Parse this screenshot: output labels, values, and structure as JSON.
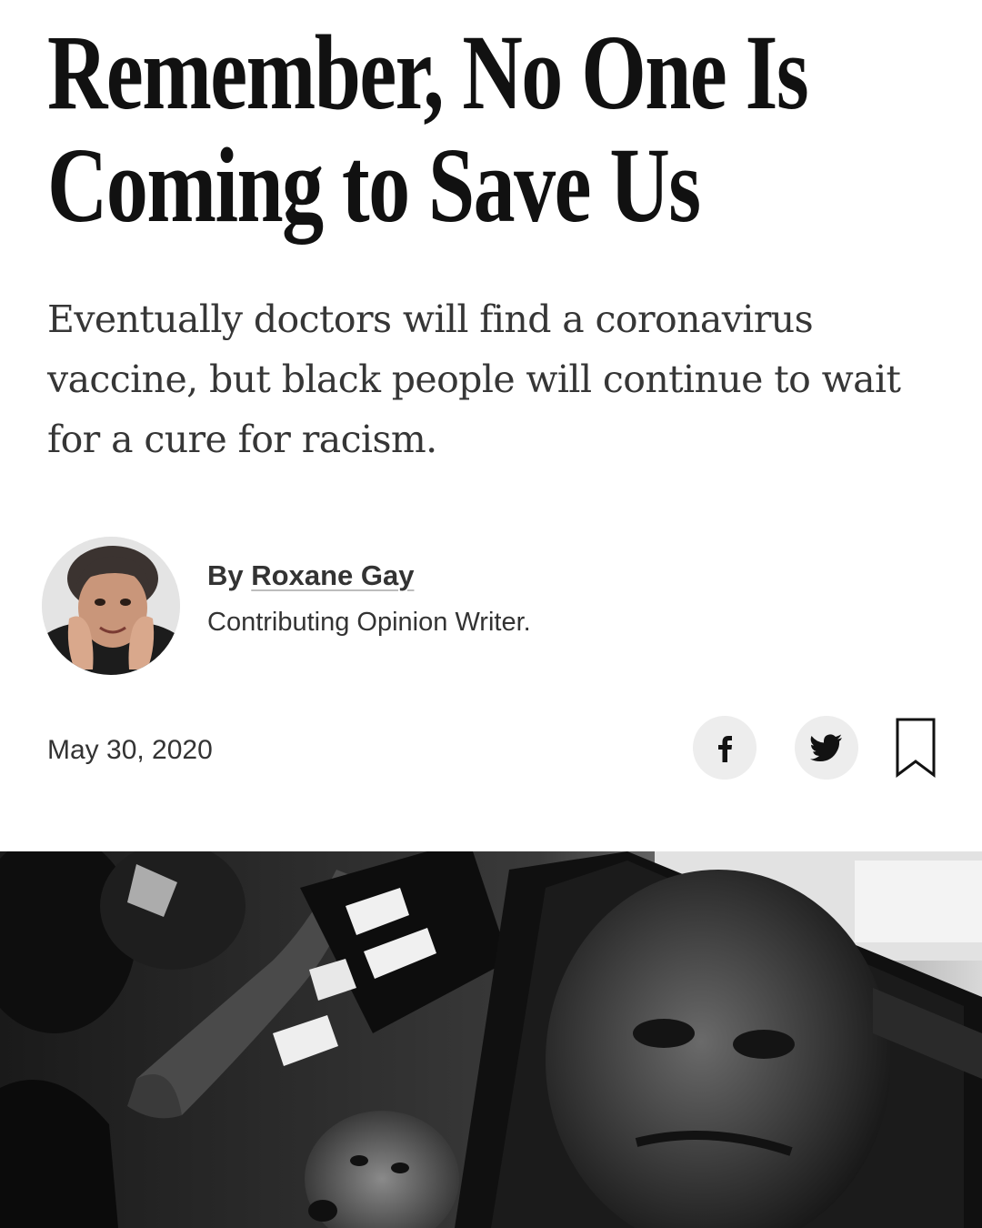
{
  "article": {
    "headline_line1": "Remember, No One Is",
    "headline_line2": "Coming to Save Us",
    "summary": "Eventually doctors will find a coronavirus vaccine, but black people will continue to wait for a cure for racism.",
    "byline_prefix": "By",
    "author": "Roxane Gay",
    "author_role": "Contributing Opinion Writer.",
    "date": "May 30, 2020"
  },
  "share": {
    "facebook_icon": "facebook-icon",
    "twitter_icon": "twitter-icon",
    "bookmark_icon": "bookmark-icon"
  },
  "colors": {
    "headline": "#111111",
    "body_text": "#333333",
    "share_button_bg": "#ededed"
  }
}
